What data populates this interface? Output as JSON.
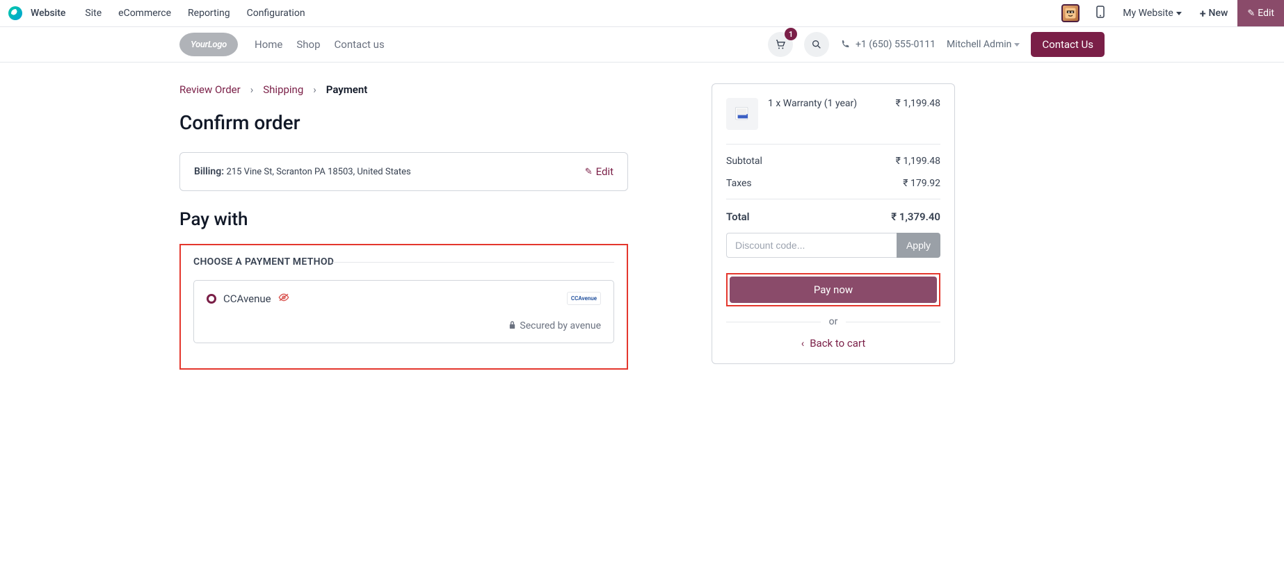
{
  "admin": {
    "app": "Website",
    "menu": [
      "Site",
      "eCommerce",
      "Reporting",
      "Configuration"
    ],
    "mywebsite": "My Website",
    "new": "New",
    "edit": "Edit"
  },
  "nav": {
    "logo": "YourLogo",
    "links": [
      "Home",
      "Shop",
      "Contact us"
    ],
    "cart_count": "1",
    "phone": "+1 (650) 555-0111",
    "user": "Mitchell Admin",
    "contact": "Contact Us"
  },
  "crumbs": {
    "review": "Review Order",
    "shipping": "Shipping",
    "payment": "Payment"
  },
  "headings": {
    "confirm": "Confirm order",
    "paywith": "Pay with",
    "choose": "CHOOSE A PAYMENT METHOD"
  },
  "billing": {
    "label": "Billing:",
    "address": "215 Vine St, Scranton PA 18503, United States",
    "edit": "Edit"
  },
  "payment": {
    "name": "CCAvenue",
    "logo": "CCAvenue",
    "secured": "Secured by avenue"
  },
  "summary": {
    "item_qty": "1 x Warranty (1 year)",
    "item_price": "₹ 1,199.48",
    "subtotal_label": "Subtotal",
    "subtotal": "₹ 1,199.48",
    "taxes_label": "Taxes",
    "taxes": "₹ 179.92",
    "total_label": "Total",
    "total": "₹ 1,379.40",
    "discount_placeholder": "Discount code...",
    "apply": "Apply",
    "paynow": "Pay now",
    "or": "or",
    "back": "Back to cart"
  }
}
